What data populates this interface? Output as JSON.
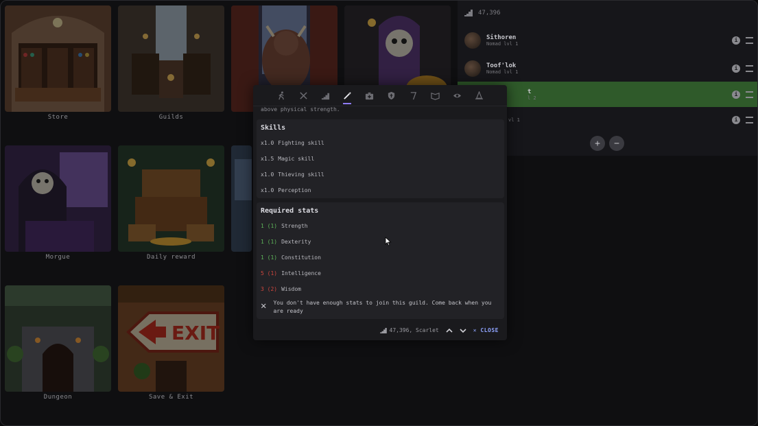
{
  "menu": {
    "tiles": [
      {
        "label": "Store"
      },
      {
        "label": "Guilds"
      },
      {
        "label": "Morgue"
      },
      {
        "label": "Daily reward"
      },
      {
        "label": "Dungeon"
      },
      {
        "label": "Save & Exit"
      }
    ],
    "exit_sign": "EXIT"
  },
  "party": {
    "gold": "47,396",
    "members": [
      {
        "name": "Sithoren",
        "sub": "Nomad lvl 1"
      },
      {
        "name": "Toof'lok",
        "sub": "Nomad lvl 1"
      },
      {
        "name": "t",
        "sub": "l 2"
      },
      {
        "name": "",
        "sub": "vl 1"
      }
    ],
    "add_symbol": "+",
    "remove_symbol": "−"
  },
  "modal": {
    "tabs": [
      "run",
      "crossed-swords",
      "stairs",
      "magic-wand",
      "medkit",
      "shield",
      "sword-broken",
      "book-open",
      "eye",
      "wizard-hat"
    ],
    "active_tab": 3,
    "desc_tail": "above physical strength.",
    "skills": {
      "title": "Skills",
      "items": [
        {
          "mult": "x1.0",
          "name": "Fighting skill"
        },
        {
          "mult": "x1.5",
          "name": "Magic skill"
        },
        {
          "mult": "x1.0",
          "name": "Thieving skill"
        },
        {
          "mult": "x1.0",
          "name": "Perception"
        }
      ]
    },
    "required": {
      "title": "Required stats",
      "items": [
        {
          "val": "1 (1)",
          "name": "Strength",
          "ok": true
        },
        {
          "val": "1 (1)",
          "name": "Dexterity",
          "ok": true
        },
        {
          "val": "1 (1)",
          "name": "Constitution",
          "ok": true
        },
        {
          "val": "5 (1)",
          "name": "Intelligence",
          "ok": false
        },
        {
          "val": "3 (2)",
          "name": "Wisdom",
          "ok": false
        }
      ]
    },
    "warning": "You don't have enough stats to join this guild. Come back when you are ready",
    "footer": {
      "player": "47,396, Scarlet",
      "close": "CLOSE"
    }
  }
}
